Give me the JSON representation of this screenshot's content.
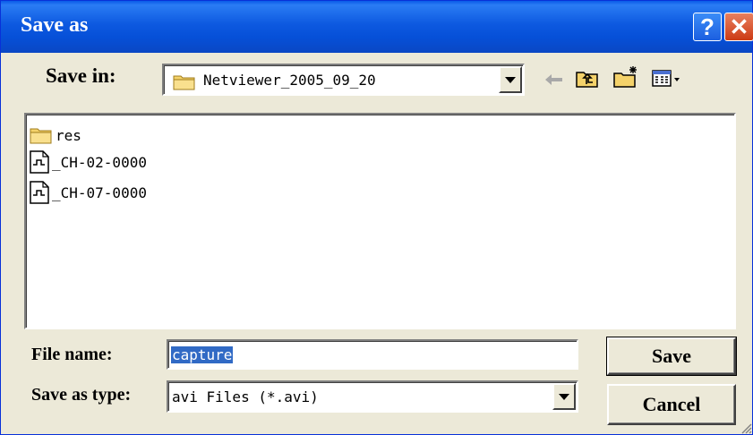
{
  "window": {
    "title": "Save as",
    "help_label": "?",
    "close_label": "✕"
  },
  "toolbar": {
    "save_in_label": "Save in:",
    "save_in_value": "Netviewer_2005_09_20",
    "icons": [
      "back-arrow-icon",
      "up-folder-icon",
      "new-folder-icon",
      "view-menu-icon"
    ]
  },
  "files": [
    {
      "name": "res",
      "icon": "folder-icon"
    },
    {
      "name": "_CH-02-0000",
      "icon": "waveform-file-icon"
    },
    {
      "name": "_CH-07-0000",
      "icon": "waveform-file-icon"
    }
  ],
  "filename": {
    "label": "File name:",
    "value": "capture"
  },
  "filetype": {
    "label": "Save as type:",
    "value": "avi Files (*.avi)"
  },
  "buttons": {
    "save": "Save",
    "cancel": "Cancel"
  },
  "colors": {
    "titlebar": "#0650d8",
    "selection": "#316ac5",
    "close": "#cc3a14",
    "face": "#ece9d8"
  }
}
